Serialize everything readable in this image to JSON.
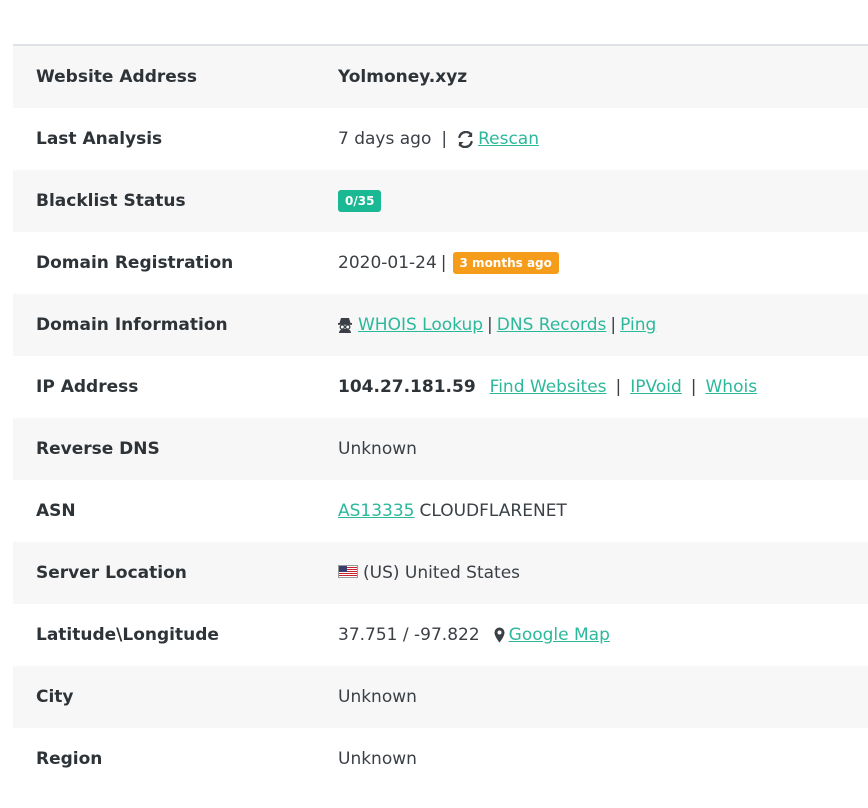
{
  "rows": [
    {
      "label": "Website Address",
      "value": "Yolmoney.xyz"
    },
    {
      "label": "Last Analysis",
      "time": "7 days ago",
      "sep": "|",
      "link": "Rescan"
    },
    {
      "label": "Blacklist Status",
      "badge": "0/35"
    },
    {
      "label": "Domain Registration",
      "date": "2020-01-24",
      "sep": "|",
      "badge": "3 months ago"
    },
    {
      "label": "Domain Information",
      "links": [
        "WHOIS Lookup",
        "DNS Records",
        "Ping"
      ],
      "sep": "|"
    },
    {
      "label": "IP Address",
      "ip": "104.27.181.59",
      "links": [
        "Find Websites",
        "IPVoid",
        "Whois"
      ],
      "sep": "|"
    },
    {
      "label": "Reverse DNS",
      "value": "Unknown"
    },
    {
      "label": "ASN",
      "link": "AS13335",
      "text": "CLOUDFLARENET"
    },
    {
      "label": "Server Location",
      "text": "(US) United States"
    },
    {
      "label": "Latitude\\Longitude",
      "coords": "37.751 / -97.822",
      "link": "Google Map"
    },
    {
      "label": "City",
      "value": "Unknown"
    },
    {
      "label": "Region",
      "value": "Unknown"
    }
  ],
  "colors": {
    "link": "#2cb89b",
    "badge_green": "#1bb894",
    "badge_orange": "#f59c1a",
    "row_alt": "#f7f7f7"
  },
  "icons": [
    "refresh-icon",
    "spy-icon",
    "us-flag-icon",
    "map-marker-icon"
  ]
}
